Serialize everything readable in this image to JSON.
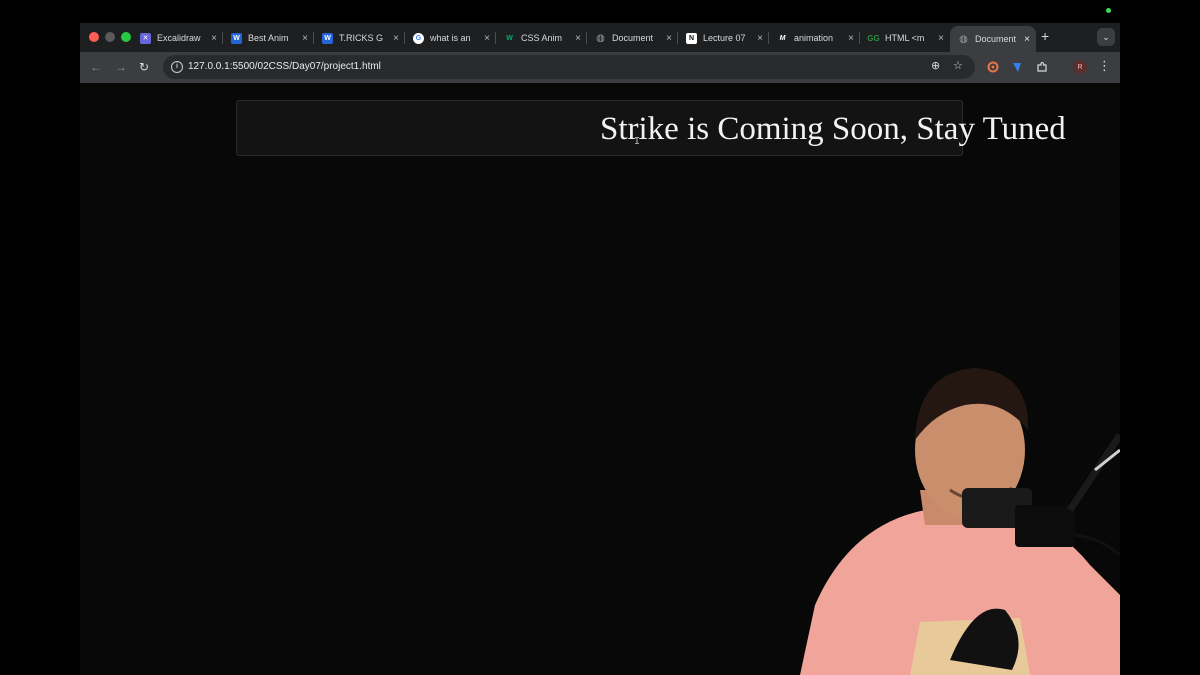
{
  "browser": {
    "tabs": [
      {
        "label": "Excalidraw",
        "icon": "excalidraw-icon",
        "color": "#6965db"
      },
      {
        "label": "Best Anim",
        "icon": "webflow-icon",
        "color": "#2564d8"
      },
      {
        "label": "T.RICKS G",
        "icon": "webflow-icon",
        "color": "#2564d8"
      },
      {
        "label": "what is an",
        "icon": "google-icon",
        "color": "#ffffff"
      },
      {
        "label": "CSS Anim",
        "icon": "w3schools-icon",
        "color": "#04aa6d"
      },
      {
        "label": "Document",
        "icon": "globe-icon",
        "color": "#9aa0a6"
      },
      {
        "label": "Lecture 07",
        "icon": "notion-icon",
        "color": "#ffffff"
      },
      {
        "label": "animation",
        "icon": "mdn-icon",
        "color": "#ffffff"
      },
      {
        "label": "HTML <m",
        "icon": "gfg-icon",
        "color": "#2f8d46"
      },
      {
        "label": "Document",
        "icon": "globe-icon",
        "color": "#9aa0a6",
        "active": true
      }
    ],
    "address": {
      "url": "127.0.0.1:5500/02CSS/Day07/project1.html"
    },
    "profile_initial": "R",
    "glyphs": {
      "close": "×",
      "new_tab": "+",
      "tab_search": "⌄",
      "back": "←",
      "forward": "→",
      "reload": "↻",
      "zoom": "⊕",
      "star": "☆",
      "menu": "⋮",
      "info": "i"
    }
  },
  "page": {
    "marquee_text": "Strike is Coming Soon, Stay Tuned",
    "cursor": "I"
  },
  "colors": {
    "page_bg": "#080808",
    "banner_bg": "#131313",
    "tab_active": "#3c3d40",
    "tabbar": "#1e1f21"
  }
}
